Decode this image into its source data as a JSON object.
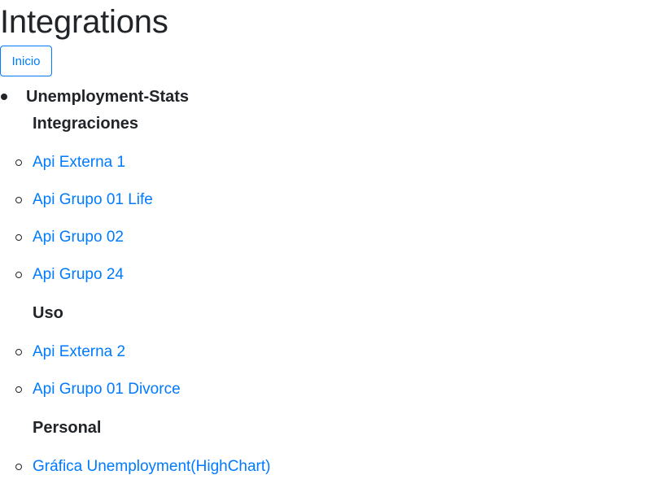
{
  "page": {
    "title": "Integrations",
    "home_button_label": "Inicio"
  },
  "group": {
    "title": "Unemployment-Stats",
    "sections": [
      {
        "heading": "Integraciones",
        "links": [
          "Api Externa 1",
          "Api Grupo 01 Life",
          "Api Grupo 02",
          "Api Grupo 24"
        ]
      },
      {
        "heading": "Uso",
        "links": [
          "Api Externa 2",
          "Api Grupo 01 Divorce"
        ]
      },
      {
        "heading": "Personal",
        "links": [
          "Gráfica Unemployment(HighChart)"
        ]
      }
    ]
  },
  "colors": {
    "link": "#007bff",
    "text": "#212529",
    "button_border": "#007bff"
  }
}
